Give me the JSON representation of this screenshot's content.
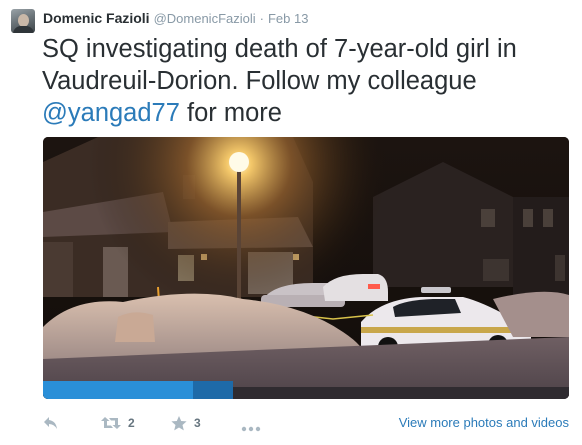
{
  "tweet": {
    "author_name": "Domenic Fazioli",
    "author_handle": "@DomenicFazioli",
    "separator": "·",
    "date": "Feb 13",
    "text_main": "SQ investigating death of 7-year-old girl in Vaudreuil-Dorion. Follow my colleague ",
    "mention": "@yangad77",
    "text_tail": " for more"
  },
  "actions": {
    "reply_icon": "reply-icon",
    "retweet_icon": "retweet-icon",
    "retweet_count": "2",
    "favorite_icon": "star-icon",
    "favorite_count": "3",
    "more_icon": "ellipsis-icon",
    "view_more_label": "View more photos and videos"
  },
  "colors": {
    "link": "#2b7bb9",
    "meta": "#8899a6",
    "action_icon": "#aab8c2"
  }
}
